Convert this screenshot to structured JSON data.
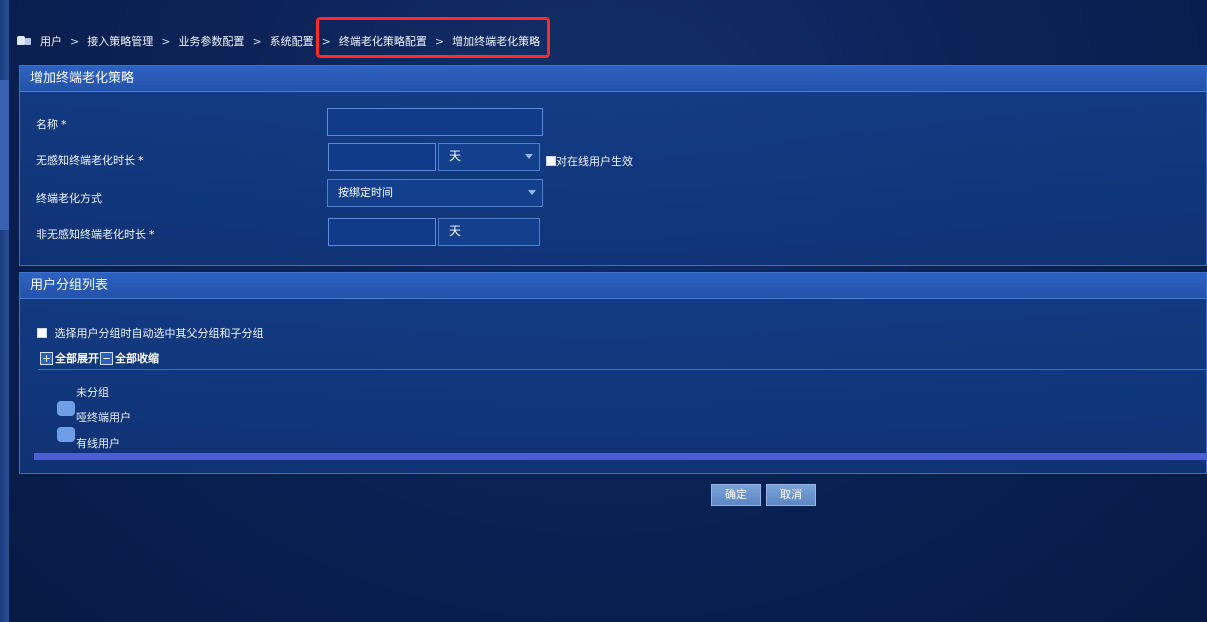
{
  "breadcrumb": {
    "items": [
      "用户",
      "接入策略管理",
      "业务参数配置",
      "系统配置",
      "终端老化策略配置",
      "增加终端老化策略"
    ],
    "separator": ">"
  },
  "policy_panel": {
    "title": "增加终端老化策略",
    "fields": {
      "name": {
        "label": "名称",
        "required_mark": "*",
        "value": ""
      },
      "unaware_duration": {
        "label": "无感知终端老化时长",
        "required_mark": "*",
        "value": "",
        "unit": "天",
        "online_checkbox_label": "对在线用户生效",
        "online_checked": false
      },
      "aging_method": {
        "label": "终端老化方式",
        "selected": "按绑定时间"
      },
      "non_unaware_duration": {
        "label": "非无感知终端老化时长",
        "required_mark": "*",
        "value": "",
        "unit": "天"
      }
    }
  },
  "group_panel": {
    "title": "用户分组列表",
    "auto_select_label": "选择用户分组时自动选中其父分组和子分组",
    "auto_select_checked": false,
    "expand_all": "全部展开",
    "collapse_all": "全部收缩",
    "tree": [
      "未分组",
      "哑终端用户",
      "有线用户"
    ]
  },
  "actions": {
    "confirm": "确定",
    "cancel": "取消"
  },
  "colors": {
    "highlight": "#ff2a2a",
    "panel_header": "#2e62c2"
  }
}
